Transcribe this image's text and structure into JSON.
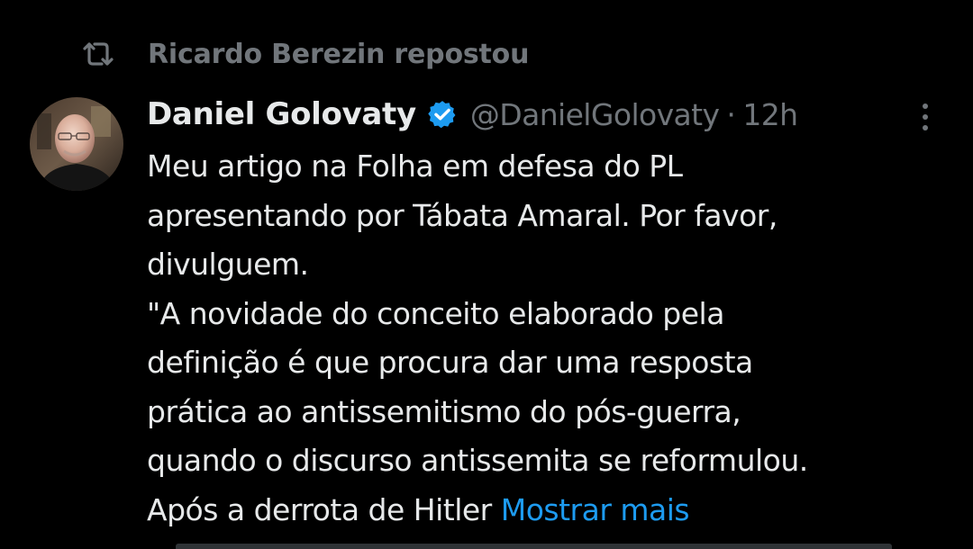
{
  "repost": {
    "icon": "repost-icon",
    "text": "Ricardo Berezin repostou"
  },
  "tweet": {
    "avatar_icon": "avatar-photo",
    "author_name": "Daniel Golovaty",
    "verified_icon": "verified-badge-icon",
    "handle": "@DanielGolovaty",
    "separator": "·",
    "timestamp": "12h",
    "more_icon": "more-options-icon",
    "body_lines": [
      "Meu artigo na Folha em defesa do PL",
      "apresentando por Tábata Amaral. Por favor,",
      "divulguem.",
      "\"A novidade do conceito elaborado pela",
      "definição é que procura dar uma resposta",
      "prática ao antissemitismo do pós-guerra,",
      "quando o discurso antissemita se reformulou.",
      "Após a derrota de Hitler"
    ],
    "show_more": "Mostrar mais"
  },
  "colors": {
    "background": "#000000",
    "text_primary": "#e7e9ea",
    "text_secondary": "#71767b",
    "link": "#1d9bf0",
    "verified": "#1d9bf0"
  }
}
